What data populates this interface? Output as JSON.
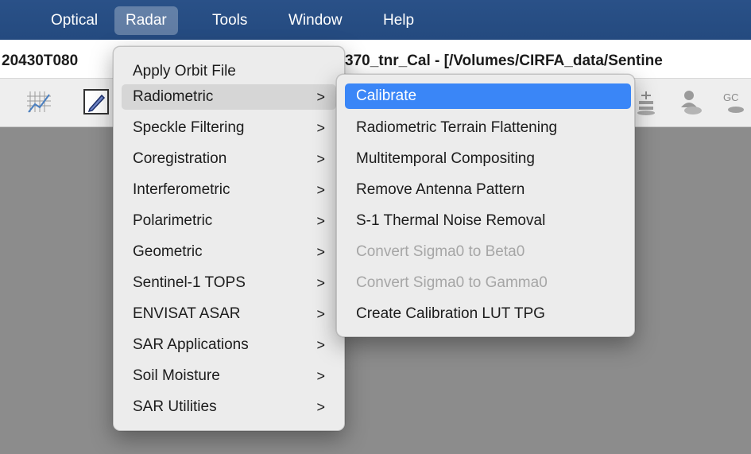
{
  "menubar": {
    "items": [
      {
        "label": "Optical"
      },
      {
        "label": "Radar"
      },
      {
        "label": "Tools"
      },
      {
        "label": "Window"
      },
      {
        "label": "Help"
      }
    ],
    "active": "Radar"
  },
  "window": {
    "title_left": "20430T080",
    "title_right": "370_tnr_Cal - [/Volumes/CIRFA_data/Sentine"
  },
  "toolbar": {
    "icons": [
      "chart-icon",
      "pen-icon",
      "tool-icon",
      "person-icon",
      "gcp-icon"
    ],
    "gcp_label": "GC"
  },
  "radar_menu": {
    "items": [
      {
        "label": "Apply Orbit File",
        "submenu": false
      },
      {
        "label": "Radiometric",
        "submenu": true
      },
      {
        "label": "Speckle Filtering",
        "submenu": true
      },
      {
        "label": "Coregistration",
        "submenu": true
      },
      {
        "label": "Interferometric",
        "submenu": true
      },
      {
        "label": "Polarimetric",
        "submenu": true
      },
      {
        "label": "Geometric",
        "submenu": true
      },
      {
        "label": "Sentinel-1 TOPS",
        "submenu": true
      },
      {
        "label": "ENVISAT ASAR",
        "submenu": true
      },
      {
        "label": "SAR Applications",
        "submenu": true
      },
      {
        "label": "Soil Moisture",
        "submenu": true
      },
      {
        "label": "SAR Utilities",
        "submenu": true
      }
    ],
    "chevron": ">"
  },
  "radiometric_submenu": {
    "items": [
      {
        "label": "Calibrate",
        "enabled": true,
        "selected": true
      },
      {
        "label": "Radiometric Terrain Flattening",
        "enabled": true,
        "selected": false
      },
      {
        "label": "Multitemporal Compositing",
        "enabled": true,
        "selected": false
      },
      {
        "label": "Remove Antenna Pattern",
        "enabled": true,
        "selected": false
      },
      {
        "label": "S-1 Thermal Noise Removal",
        "enabled": true,
        "selected": false
      },
      {
        "label": "Convert Sigma0 to Beta0",
        "enabled": false,
        "selected": false
      },
      {
        "label": "Convert Sigma0 to Gamma0",
        "enabled": false,
        "selected": false
      },
      {
        "label": "Create Calibration LUT TPG",
        "enabled": true,
        "selected": false
      }
    ]
  },
  "colors": {
    "menubar_bg": "#2a5188",
    "selected_bg": "#3a86f7",
    "workspace_bg": "#8c8c8c",
    "disabled_text": "#a6a6a6"
  }
}
